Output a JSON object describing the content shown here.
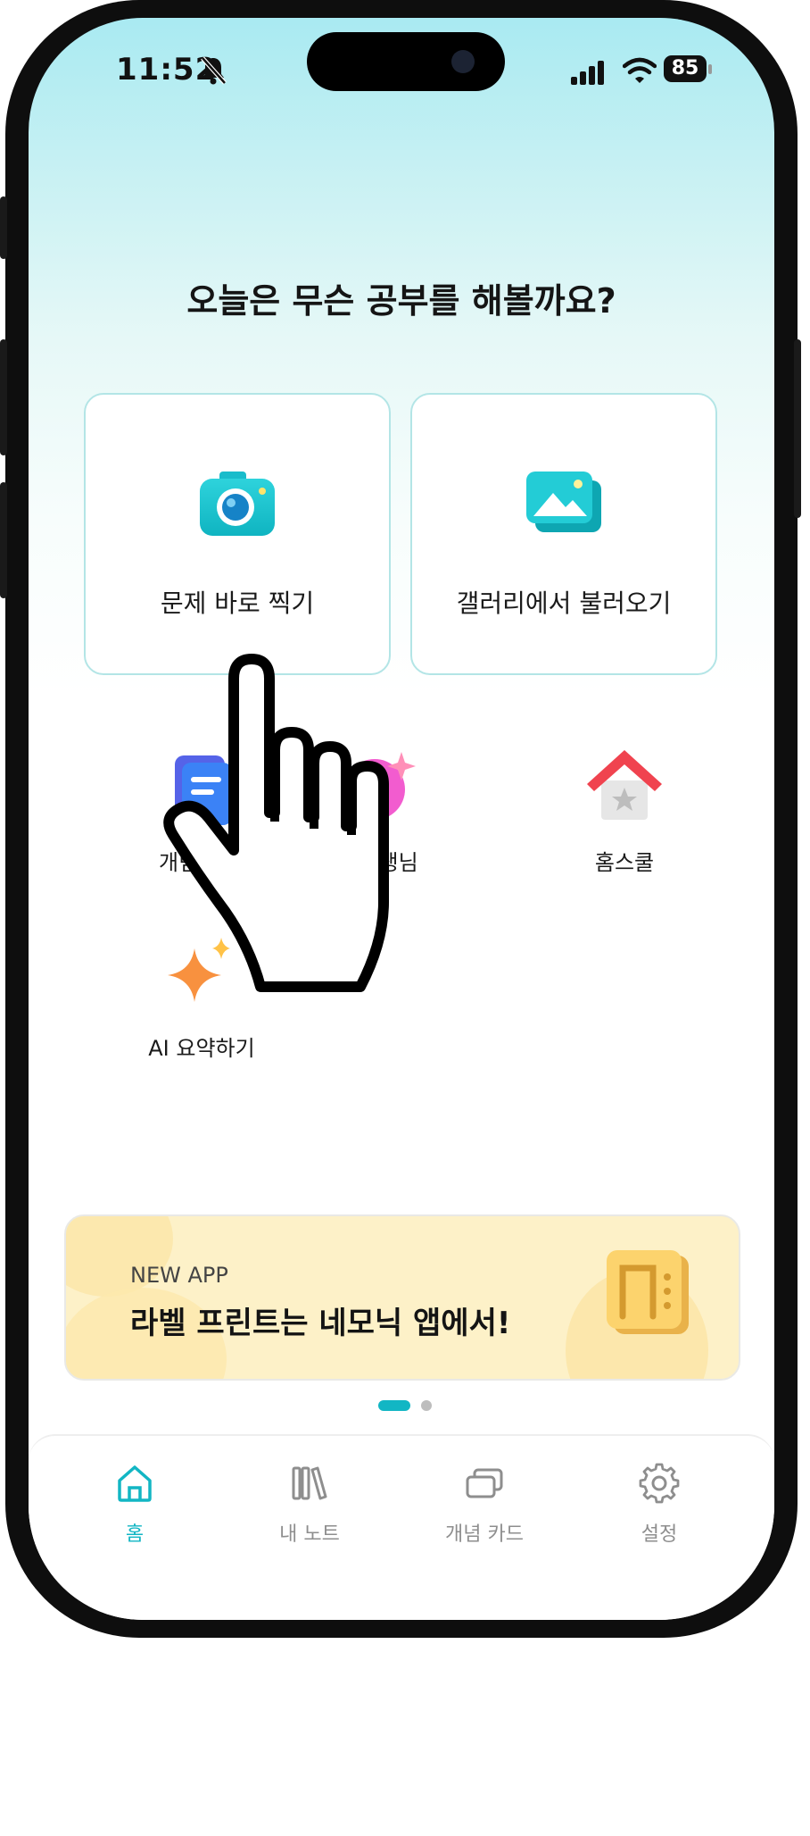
{
  "status_bar": {
    "time": "11:52",
    "battery": "85"
  },
  "headline": "오늘은 무슨 공부를 해볼까요?",
  "cards": [
    {
      "label": "문제 바로 찍기",
      "icon": "camera-icon"
    },
    {
      "label": "갤러리에서 불러오기",
      "icon": "gallery-icon"
    }
  ],
  "features": [
    {
      "label": "개념 카드",
      "icon": "concept-card-icon"
    },
    {
      "label": "AI 선생님",
      "icon": "ai-teacher-icon"
    },
    {
      "label": "홈스쿨",
      "icon": "homeschool-icon"
    },
    {
      "label": "AI 요약하기",
      "icon": "sparkle-icon"
    }
  ],
  "banner": {
    "tag": "NEW APP",
    "title": "라벨 프린트는 네모닉 앱에서!"
  },
  "tabs": [
    {
      "label": "홈",
      "icon": "home-icon",
      "active": true
    },
    {
      "label": "내 노트",
      "icon": "library-icon"
    },
    {
      "label": "개념 카드",
      "icon": "cards-icon"
    },
    {
      "label": "설정",
      "icon": "gear-icon"
    }
  ],
  "colors": {
    "accent": "#12b6c4",
    "card_border": "#b3e5e6",
    "banner_bg": "#fdf1c8"
  }
}
